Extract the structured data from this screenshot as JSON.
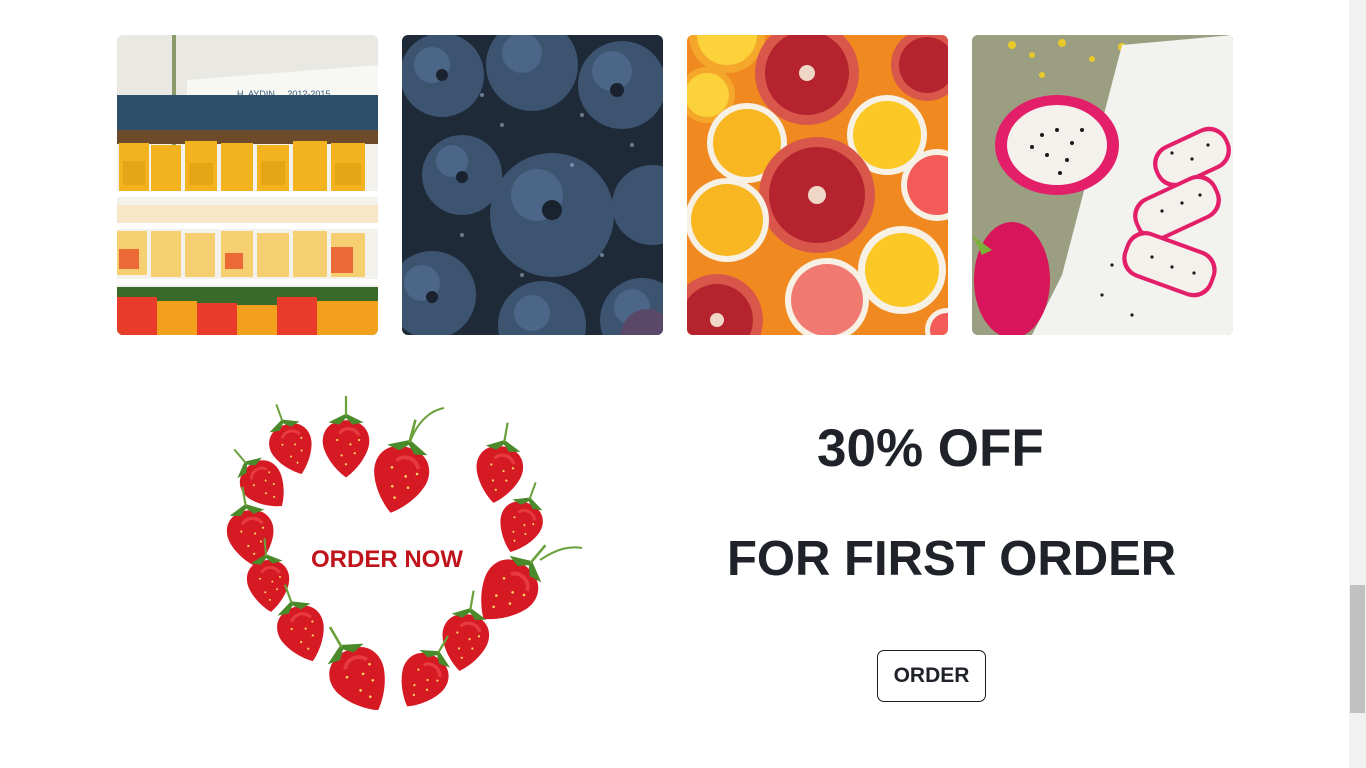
{
  "gallery": {
    "images": [
      {
        "name": "fruit-market-photo"
      },
      {
        "name": "blueberries-photo"
      },
      {
        "name": "citrus-pomegranate-photo"
      },
      {
        "name": "dragon-fruit-photo"
      }
    ],
    "market_sign_text": "H. AYDIN ... 2012-2015"
  },
  "promo": {
    "order_now_label": "ORDER NOW",
    "headline_discount": "30% OFF",
    "headline_subtitle": "FOR FIRST ORDER",
    "order_button_label": "ORDER",
    "accent_color": "#c0141c",
    "text_color": "#20222a"
  },
  "scrollbar": {
    "position_fraction": 0.85
  }
}
